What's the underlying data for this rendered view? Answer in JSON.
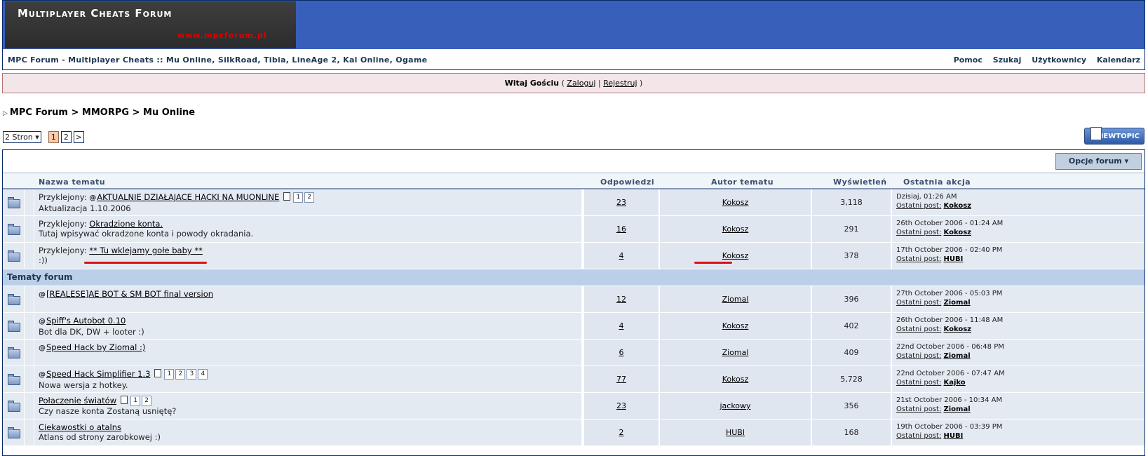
{
  "header": {
    "logo_title": "Multiplayer Cheats Forum",
    "logo_url": "www.mpcforum.pl",
    "site_description": "MPC Forum - Multiplayer Cheats :: Mu Online, SilkRoad, Tibia, LineAge 2, Kal Online, Ogame",
    "nav": [
      "Pomoc",
      "Szukaj",
      "Użytkownicy",
      "Kalendarz"
    ]
  },
  "welcome": {
    "greeting": "Witaj Gościu",
    "open_paren": "(",
    "login": "Zaloguj",
    "sep": "|",
    "register": "Rejestruj",
    "close_paren": ")"
  },
  "breadcrumb": [
    "MPC Forum",
    "MMORPG",
    "Mu Online"
  ],
  "breadcrumb_sep": ">",
  "pagination": {
    "pages_label": "2 Stron",
    "pages": [
      "1",
      "2"
    ],
    "current": "1",
    "next": ">"
  },
  "new_topic_label": "NEWTOPIC",
  "options_label": "Opcje forum",
  "columns": {
    "title": "Nazwa tematu",
    "replies": "Odpowiedzi",
    "author": "Autor tematu",
    "views": "Wyświetleń",
    "last": "Ostatnia akcja"
  },
  "last_post_label": "Ostatni post:",
  "pinned_prefix": "Przyklejony:",
  "pinned_topics": [
    {
      "title": "AKTUALNIE DZIAŁAJACE HACKI NA MUONLINE",
      "desc": "Aktualizacja 1.10.2006",
      "locked": true,
      "pages": [
        "1",
        "2"
      ],
      "replies": "23",
      "author": "Kokosz",
      "views": "3,118",
      "last_date": "Dzisiaj, 01:26 AM",
      "last_user": "Kokosz"
    },
    {
      "title": "Okradzione konta.",
      "desc": "Tutaj wpisywać okradzone konta i powody okradania.",
      "locked": false,
      "pages": [],
      "replies": "16",
      "author": "Kokosz",
      "views": "291",
      "last_date": "26th October 2006 - 01:24 AM",
      "last_user": "Kokosz"
    },
    {
      "title": "** Tu wklejamy gołe baby **",
      "desc": ":))",
      "locked": false,
      "pages": [],
      "replies": "4",
      "author": "Kokosz",
      "views": "378",
      "last_date": "17th October 2006 - 02:40 PM",
      "last_user": "HUBI"
    }
  ],
  "section_title": "Tematy forum",
  "topics": [
    {
      "title": "[REALESE]AE BOT & SM BOT final version",
      "desc": "",
      "locked": true,
      "pages": [],
      "replies": "12",
      "author": "Ziomal",
      "views": "396",
      "last_date": "27th October 2006 - 05:03 PM",
      "last_user": "Ziomal"
    },
    {
      "title": "Spiff's Autobot 0.10",
      "desc": "Bot dla DK, DW + looter :)",
      "locked": true,
      "pages": [],
      "replies": "4",
      "author": "Kokosz",
      "views": "402",
      "last_date": "26th October 2006 - 11:48 AM",
      "last_user": "Kokosz"
    },
    {
      "title": "Speed Hack by Ziomal :)",
      "desc": "",
      "locked": true,
      "pages": [],
      "replies": "6",
      "author": "Ziomal",
      "views": "409",
      "last_date": "22nd October 2006 - 06:48 PM",
      "last_user": "Ziomal"
    },
    {
      "title": "Speed Hack Simplifier 1.3",
      "desc": "Nowa wersja z hotkey.",
      "locked": true,
      "pages": [
        "1",
        "2",
        "3",
        "4"
      ],
      "replies": "77",
      "author": "Kokosz",
      "views": "5,728",
      "last_date": "22nd October 2006 - 07:47 AM",
      "last_user": "Kajko"
    },
    {
      "title": "Połaczenie światów",
      "desc": "Czy nasze konta Zostaną usniętę?",
      "locked": false,
      "pages": [
        "1",
        "2"
      ],
      "replies": "23",
      "author": "jackowy",
      "views": "356",
      "last_date": "21st October 2006 - 10:34 AM",
      "last_user": "Ziomal"
    },
    {
      "title": "Ciekawostki o atalns",
      "desc": "Atlans od strony zarobkowej :)",
      "locked": false,
      "pages": [],
      "replies": "2",
      "author": "HUBI",
      "views": "168",
      "last_date": "19th October 2006 - 03:39 PM",
      "last_user": "HUBI"
    }
  ],
  "lock_glyph": "@",
  "annotation_color": "#e11111"
}
